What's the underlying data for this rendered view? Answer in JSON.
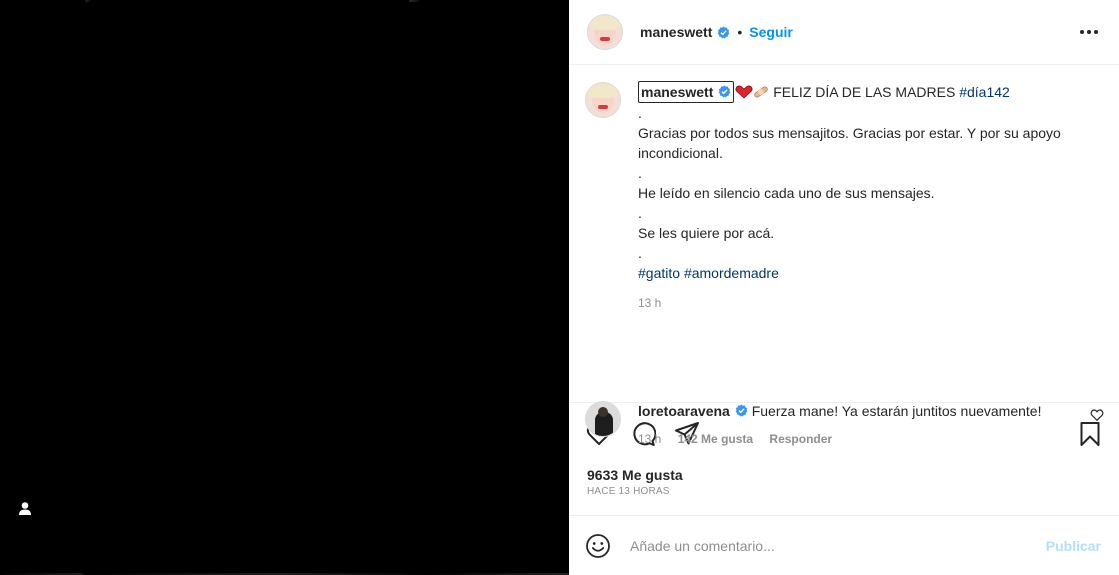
{
  "header": {
    "username": "maneswett",
    "separator": "•",
    "follow_label": "Seguir"
  },
  "caption": {
    "username": "maneswett",
    "title_text": "FELIZ DÍA DE LAS MADRES",
    "title_tag": "#día142",
    "lines": [
      ".",
      "Gracias por todos sus mensajitos. Gracias por estar. Y por su apoyo incondicional.",
      ".",
      "He leído en silencio cada uno de sus mensajes.",
      ".",
      "Se les quiere por acá.",
      "."
    ],
    "hashtags": [
      "#gatito",
      "#amordemadre"
    ],
    "time": "13 h"
  },
  "comment": {
    "username": "loretoaravena",
    "text": "Fuerza mane! Ya estarán juntitos nuevamente!",
    "time": "13 h",
    "likes": "142 Me gusta",
    "reply_label": "Responder"
  },
  "stats": {
    "likes": "9633 Me gusta",
    "time_ago": "HACE 13 HORAS"
  },
  "composer": {
    "placeholder": "Añade un comentario...",
    "post_label": "Publicar"
  },
  "colors": {
    "accent": "#0095f6",
    "verified": "#3897f0",
    "hashtag": "#00376b",
    "post_disabled": "#b2dffc"
  },
  "icons": [
    "user-tag-icon",
    "verified-icon",
    "more-options-icon",
    "heart-emoji",
    "bandage-emoji",
    "like-icon",
    "comment-icon",
    "share-icon",
    "save-icon",
    "emoji-icon"
  ]
}
